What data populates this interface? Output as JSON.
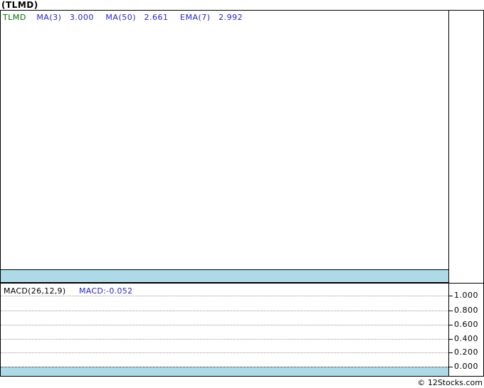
{
  "page": {
    "title": "(TLMD)"
  },
  "main_chart": {
    "legend": {
      "symbol": "TLMD",
      "items": [
        {
          "label": "MA(3)",
          "value": "3.000"
        },
        {
          "label": "MA(50)",
          "value": "2.661"
        },
        {
          "label": "EMA(7)",
          "value": "2.992"
        }
      ]
    }
  },
  "macd_panel": {
    "label": "MACD(26,12,9)",
    "value_label": "MACD:-0.052",
    "axis_ticks": [
      "1.000",
      "0.800",
      "0.600",
      "0.400",
      "0.200",
      "0.000"
    ]
  },
  "footer": {
    "copyright": "© 12Stocks.com"
  },
  "colors": {
    "band_cyan": "#aedae8",
    "legend_blue": "#2424cc",
    "symbol_green": "#007000",
    "grid_gray": "#999999",
    "border_black": "#000000",
    "background": "#ffffff"
  },
  "chart_data": [
    {
      "type": "line",
      "title": "(TLMD)",
      "panel": "price",
      "indicators": [
        {
          "name": "MA(3)",
          "value": 3.0
        },
        {
          "name": "MA(50)",
          "value": 2.661
        },
        {
          "name": "EMA(7)",
          "value": 2.992
        }
      ],
      "series": [],
      "x": [],
      "note_layout": {
        "grid": false,
        "y_axis_labels_visible": false
      }
    },
    {
      "type": "line",
      "title": "MACD(26,12,9)",
      "panel": "macd",
      "values": {
        "MACD": -0.052
      },
      "ylim": [
        0.0,
        1.0
      ],
      "yticks": [
        1.0,
        0.8,
        0.6,
        0.4,
        0.2,
        0.0
      ],
      "series": [],
      "x": [],
      "note_layout": {
        "grid": true,
        "grid_style": "dotted",
        "zero_line": "dotted-black",
        "legend_position": "top-left"
      }
    }
  ]
}
